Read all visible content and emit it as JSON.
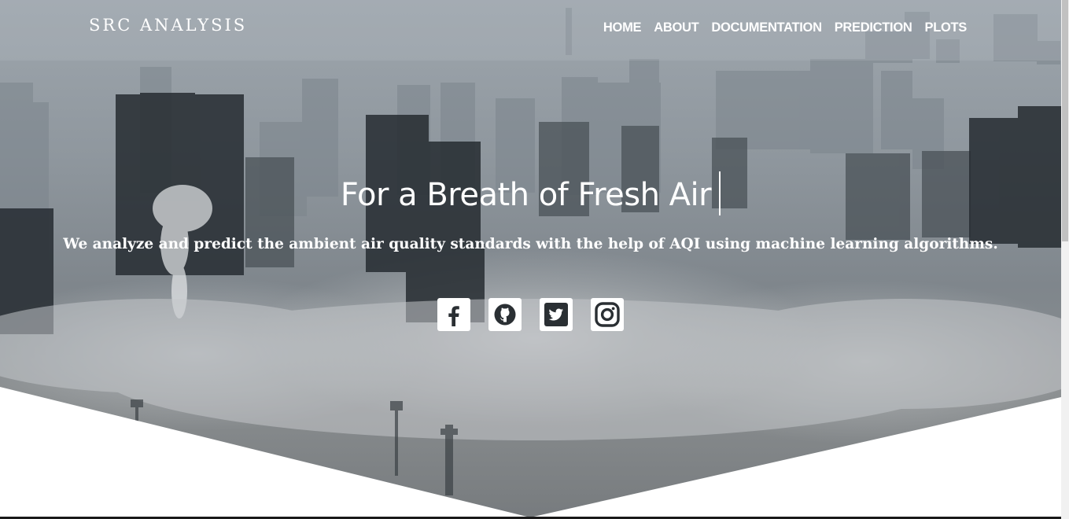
{
  "brand": "SRC ANALYSIS",
  "nav": [
    {
      "label": "HOME"
    },
    {
      "label": "ABOUT"
    },
    {
      "label": "DOCUMENTATION"
    },
    {
      "label": "PREDICTION"
    },
    {
      "label": "PLOTS"
    }
  ],
  "hero": {
    "title": "For a Breath of Fresh Air",
    "subtitle": "We analyze and predict the ambient air quality standards with the help of AQI using machine learning algorithms."
  },
  "social": [
    {
      "icon": "facebook-icon"
    },
    {
      "icon": "github-icon"
    },
    {
      "icon": "twitter-icon"
    },
    {
      "icon": "instagram-icon"
    }
  ],
  "colors": {
    "text": "#ffffff",
    "haze": "#8f979e",
    "background": "#ffffff"
  }
}
